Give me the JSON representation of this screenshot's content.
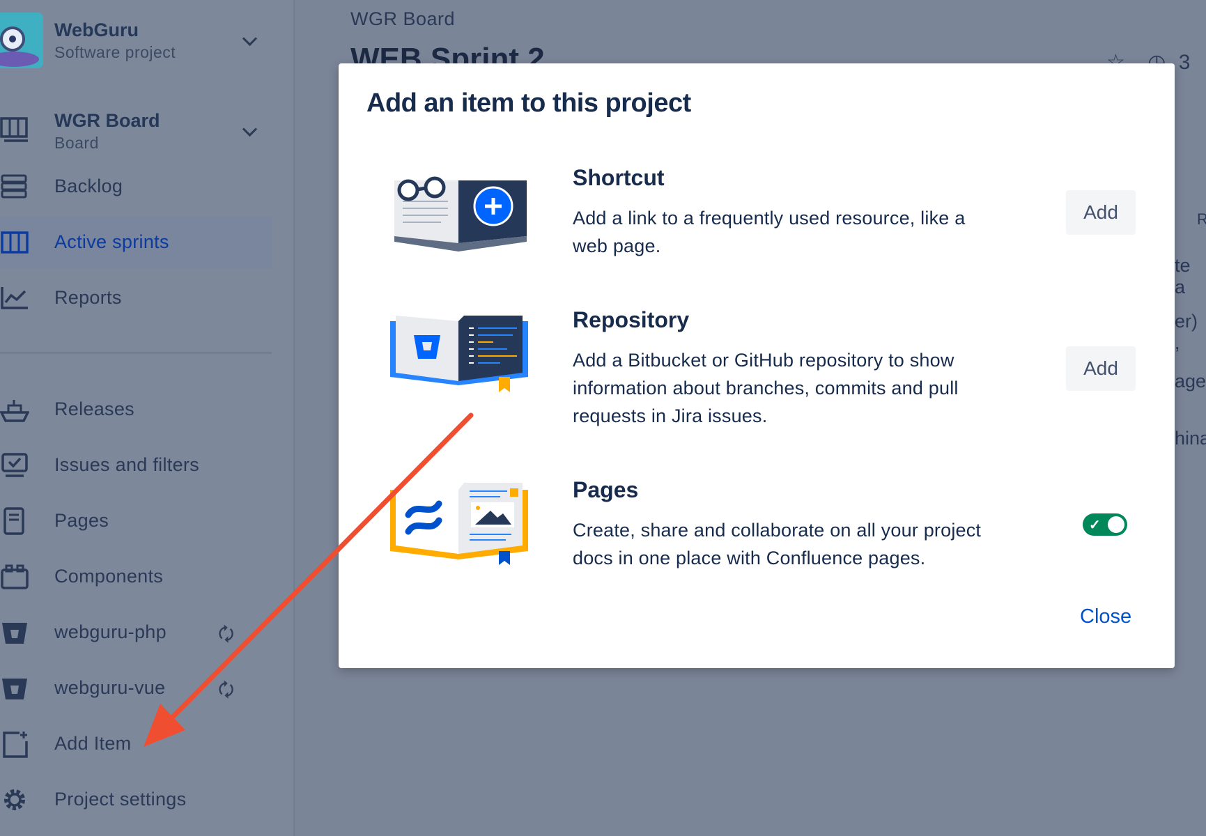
{
  "sidebar": {
    "project": {
      "name": "WebGuru",
      "type": "Software project"
    },
    "board": {
      "name": "WGR Board",
      "type": "Board"
    },
    "items": [
      {
        "label": "Backlog",
        "icon": "backlog-icon"
      },
      {
        "label": "Active sprints",
        "icon": "active-sprints-icon",
        "active": true
      },
      {
        "label": "Reports",
        "icon": "reports-icon"
      },
      {
        "label": "Releases",
        "icon": "releases-ship-icon"
      },
      {
        "label": "Issues and filters",
        "icon": "issues-icon"
      },
      {
        "label": "Pages",
        "icon": "pages-icon"
      },
      {
        "label": "Components",
        "icon": "components-icon"
      },
      {
        "label": "webguru-php",
        "icon": "bitbucket-repo-icon"
      },
      {
        "label": "webguru-vue",
        "icon": "bitbucket-repo-icon"
      },
      {
        "label": "Add Item",
        "icon": "add-item-icon"
      },
      {
        "label": "Project settings",
        "icon": "gear-icon"
      }
    ]
  },
  "main": {
    "breadcrumb": "WGR Board",
    "sprint_title": "WEB Sprint 2",
    "header_count": "3",
    "bg_fragments": [
      "R",
      "te a",
      "er) ,",
      "age",
      "hina"
    ]
  },
  "modal": {
    "title": "Add an item to this project",
    "rows": [
      {
        "title": "Shortcut",
        "description": "Add a link to a frequently used resource, like a web page.",
        "button": "Add"
      },
      {
        "title": "Repository",
        "description": "Add a Bitbucket or GitHub repository to show information about branches, commits and pull requests in Jira issues.",
        "button": "Add"
      },
      {
        "title": "Pages",
        "description": "Create, share and collaborate on all your project docs in one place with Confluence pages.",
        "toggle_on": true
      }
    ],
    "close_label": "Close"
  },
  "colors": {
    "overlay": "#7b8598",
    "accent_blue": "#0052CC",
    "toggle_green": "#00875A",
    "arrow_red": "#F04E31"
  }
}
